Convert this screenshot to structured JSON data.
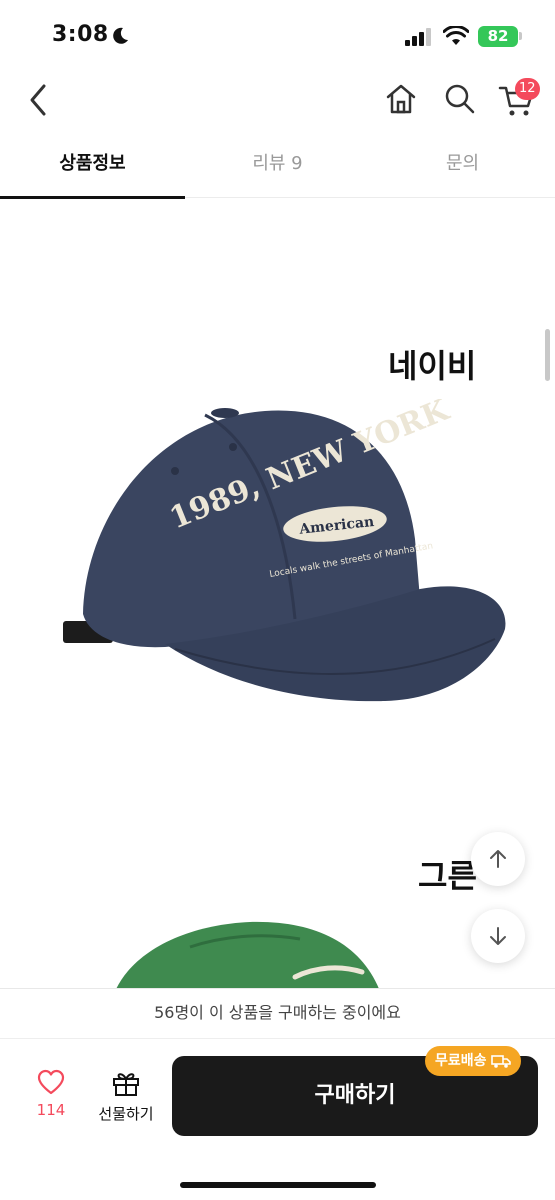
{
  "status_bar": {
    "time": "3:08",
    "battery": "82"
  },
  "header": {
    "cart_count": "12"
  },
  "tabs": [
    {
      "label": "상품정보",
      "active": true
    },
    {
      "label": "리뷰 9",
      "active": false
    },
    {
      "label": "문의",
      "active": false
    }
  ],
  "content": {
    "color_label_1": "네이비",
    "color_label_2": "그른",
    "cap_text": {
      "year_city": "1989, NEW YORK",
      "badge": "American",
      "sub": "Locals walk the streets of Manhattan"
    }
  },
  "bottom": {
    "promo_text": "56명이 이 상품을 구매하는 중이에요",
    "like_count": "114",
    "gift_label": "선물하기",
    "buy_label": "구매하기",
    "free_shipping_label": "무료배송"
  },
  "colors": {
    "accent": "#f44a5c",
    "buy_button": "#1a1a1a",
    "shipping_badge": "#f5a623",
    "cap_navy": "#3a4560",
    "cap_green": "#3f8a4f"
  }
}
